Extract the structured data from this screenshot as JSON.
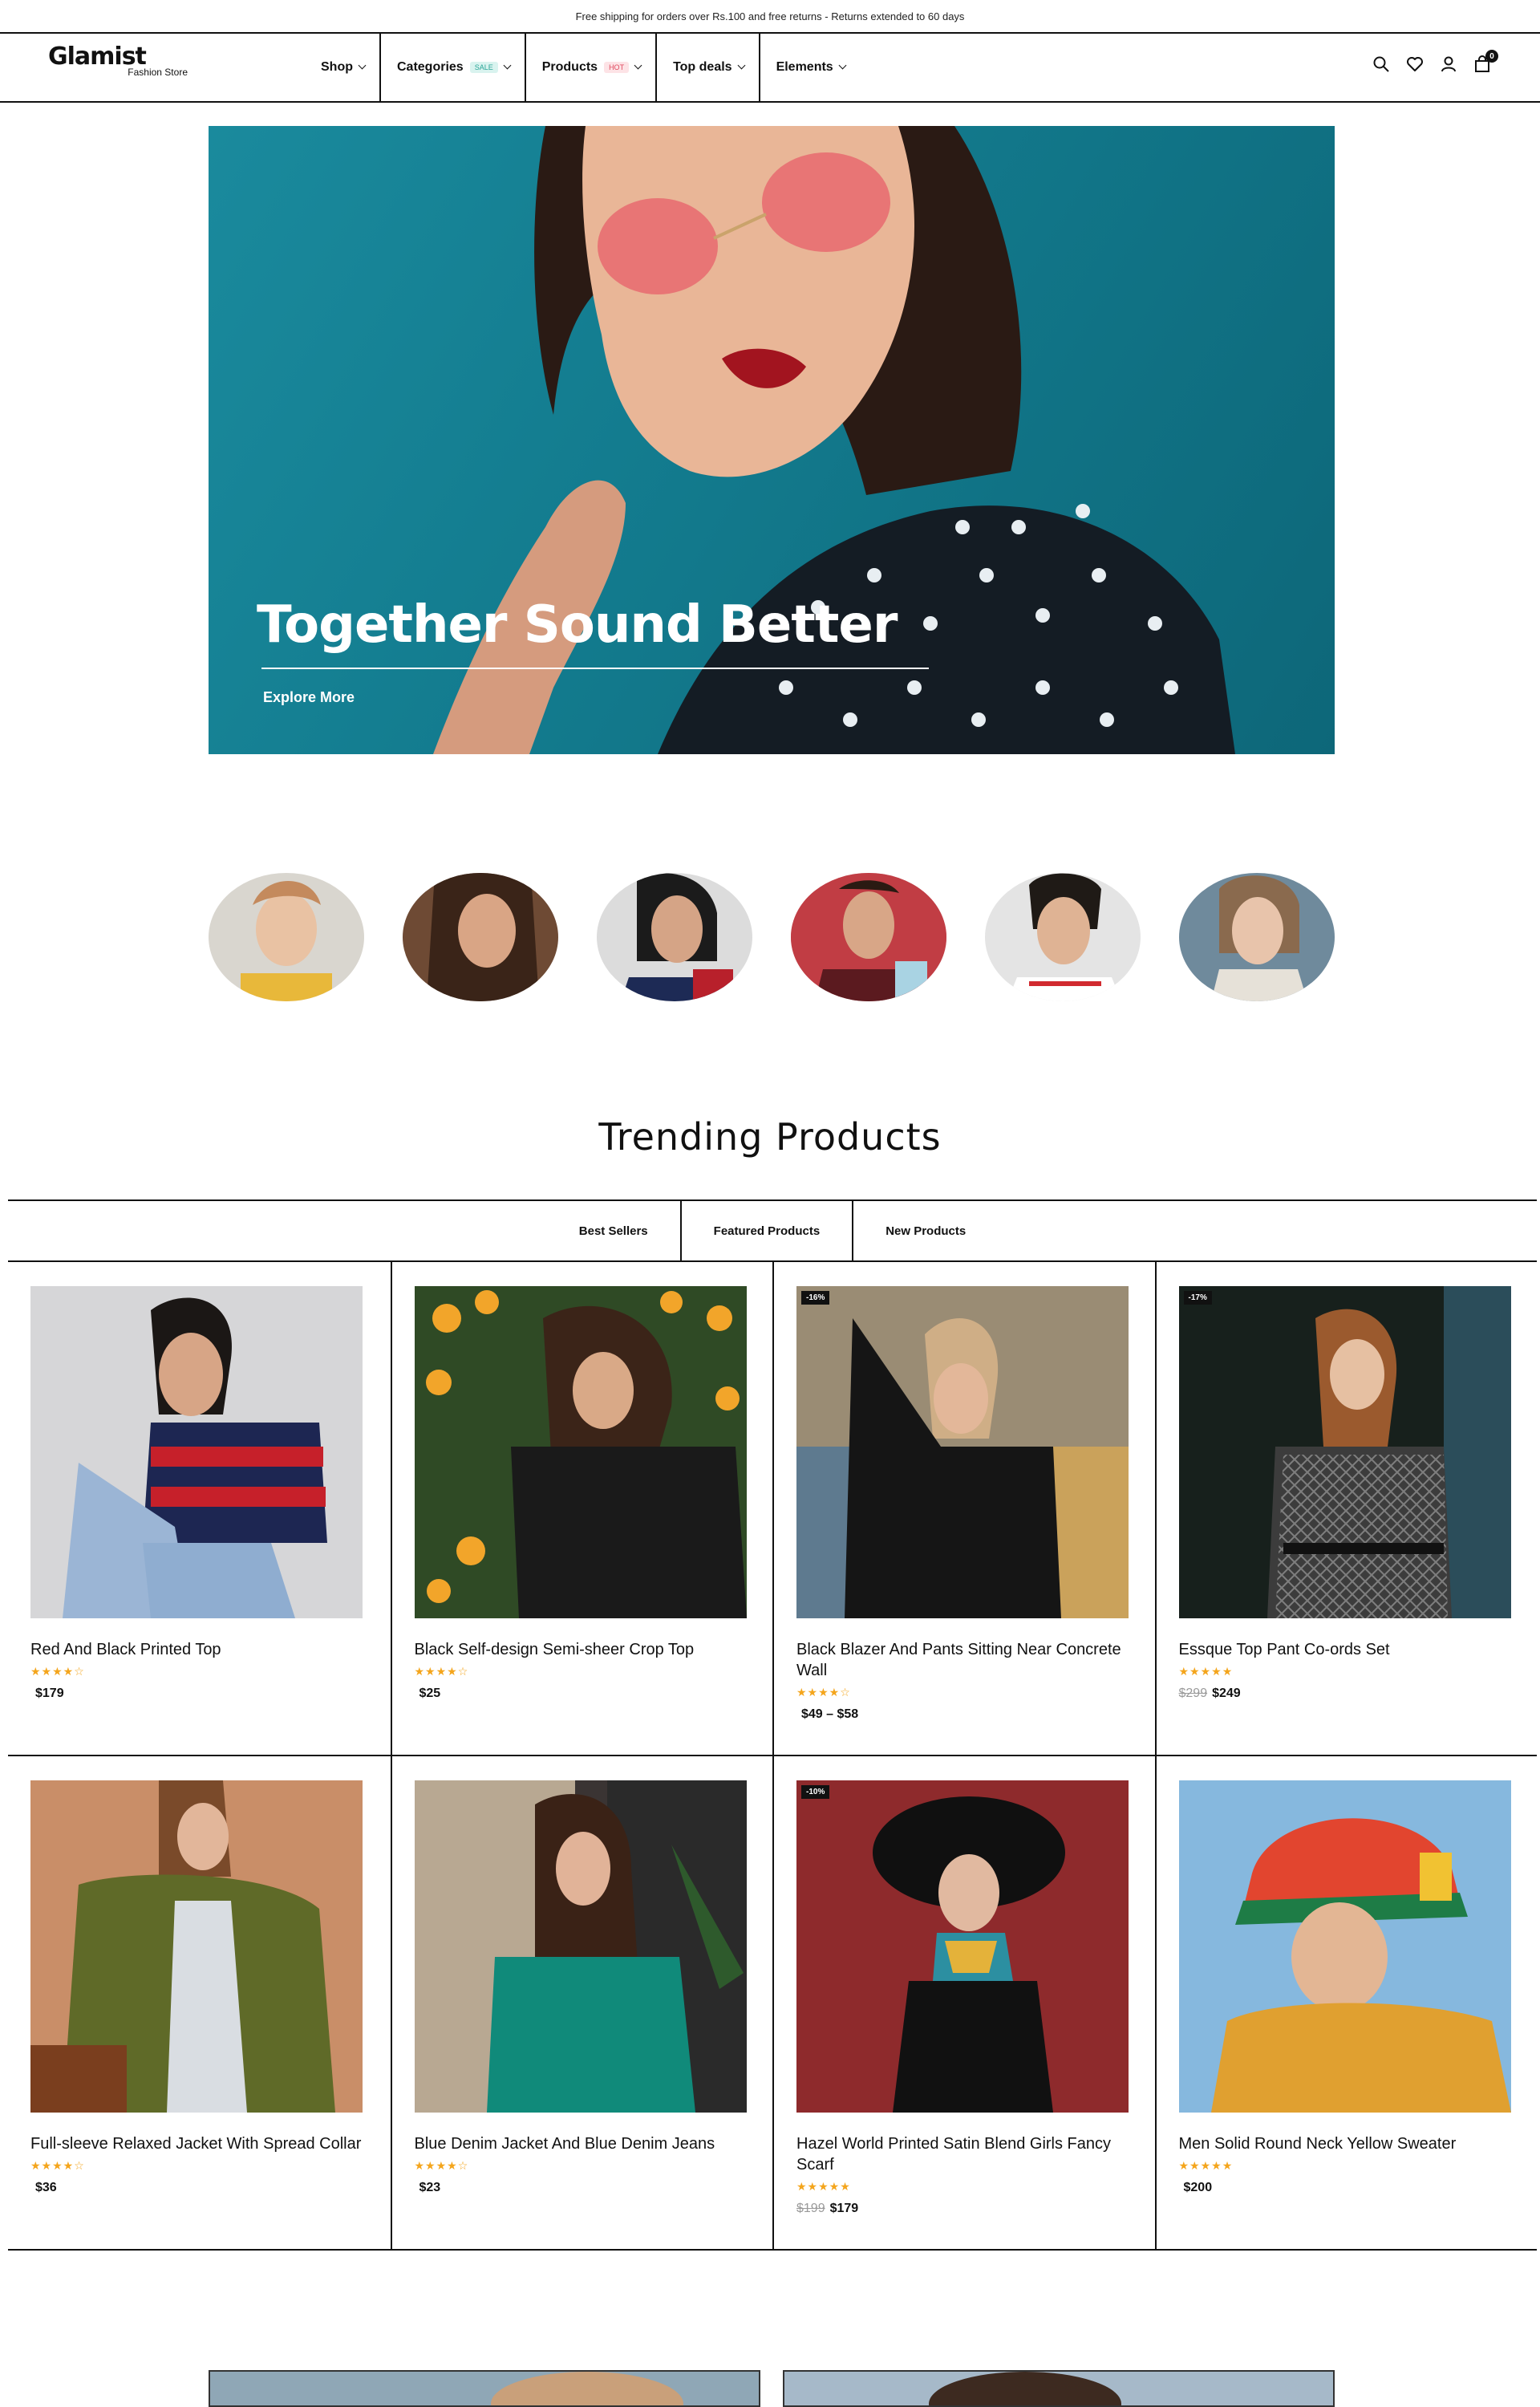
{
  "announcement": "Free shipping for orders over Rs.100 and free returns - Returns extended to 60 days",
  "brand": {
    "name": "Glamist",
    "tagline": "Fashion Store"
  },
  "nav": [
    {
      "label": "Shop",
      "badge": ""
    },
    {
      "label": "Categories",
      "badge": "SALE"
    },
    {
      "label": "Products",
      "badge": "HOT"
    },
    {
      "label": "Top deals",
      "badge": ""
    },
    {
      "label": "Elements",
      "badge": ""
    }
  ],
  "header_icons": [
    "search-icon",
    "heart-icon",
    "user-icon",
    "bag-icon"
  ],
  "cart_count": "0",
  "hero": {
    "title": "Together Sound Better",
    "link": "Explore More"
  },
  "trending": {
    "title": "Trending Products",
    "tabs": [
      "Best Sellers",
      "Featured Products",
      "New Products"
    ]
  },
  "products": [
    {
      "name": "Red And Black Printed Top",
      "stars": "★★★★☆",
      "old_price": "",
      "price": "$179",
      "discount": ""
    },
    {
      "name": "Black Self-design Semi-sheer Crop Top",
      "stars": "★★★★☆",
      "old_price": "",
      "price": "$25",
      "discount": ""
    },
    {
      "name": "Black Blazer And Pants Sitting Near Concrete Wall",
      "stars": "★★★★☆",
      "old_price": "",
      "price": "$49 – $58",
      "discount": "-16%"
    },
    {
      "name": "Essque Top Pant Co-ords Set",
      "stars": "★★★★★",
      "old_price": "$299",
      "price": "$249",
      "discount": "-17%"
    },
    {
      "name": "Full-sleeve Relaxed Jacket With Spread Collar",
      "stars": "★★★★☆",
      "old_price": "",
      "price": "$36",
      "discount": ""
    },
    {
      "name": "Blue Denim Jacket And Blue Denim Jeans",
      "stars": "★★★★☆",
      "old_price": "",
      "price": "$23",
      "discount": ""
    },
    {
      "name": "Hazel World Printed Satin Blend Girls Fancy Scarf",
      "stars": "★★★★★",
      "old_price": "$199",
      "price": "$179",
      "discount": "-10%"
    },
    {
      "name": "Men Solid Round Neck Yellow Sweater",
      "stars": "★★★★★",
      "old_price": "",
      "price": "$200",
      "discount": ""
    }
  ],
  "colors": {
    "accent_star": "#f4a51c",
    "hero_bg": "#137c8f",
    "text": "#111111"
  }
}
